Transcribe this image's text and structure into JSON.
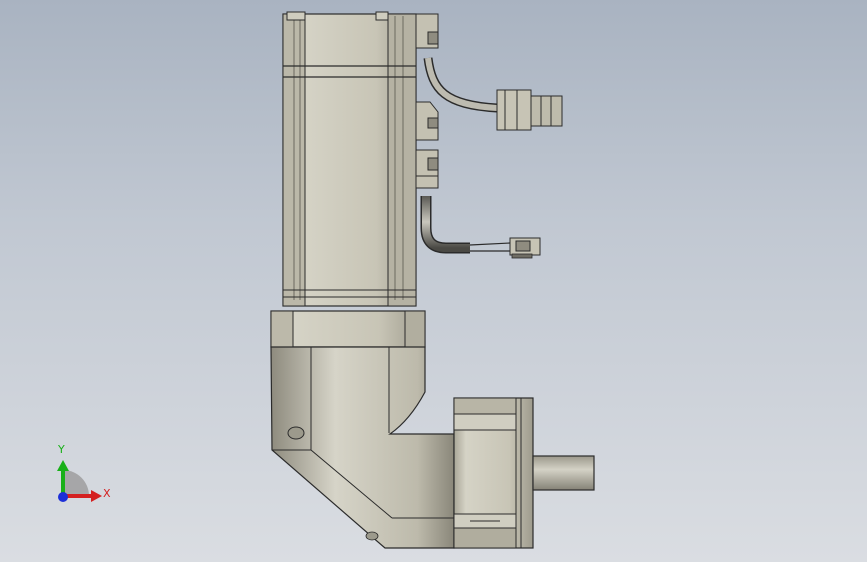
{
  "viewport": {
    "background_top": "#a9b3c1",
    "background_bottom": "#dadde2"
  },
  "model": {
    "body_color": "#c9c6b8",
    "edge_color": "#2b2b2b",
    "shade_color": "#8f8c80",
    "dark_color": "#4d4c47"
  },
  "triad": {
    "x_label": "X",
    "y_label": "Y",
    "x_color": "#d42020",
    "y_color": "#18b018",
    "z_color": "#1c2fd8",
    "icon": "coordinate-triad-icon"
  }
}
